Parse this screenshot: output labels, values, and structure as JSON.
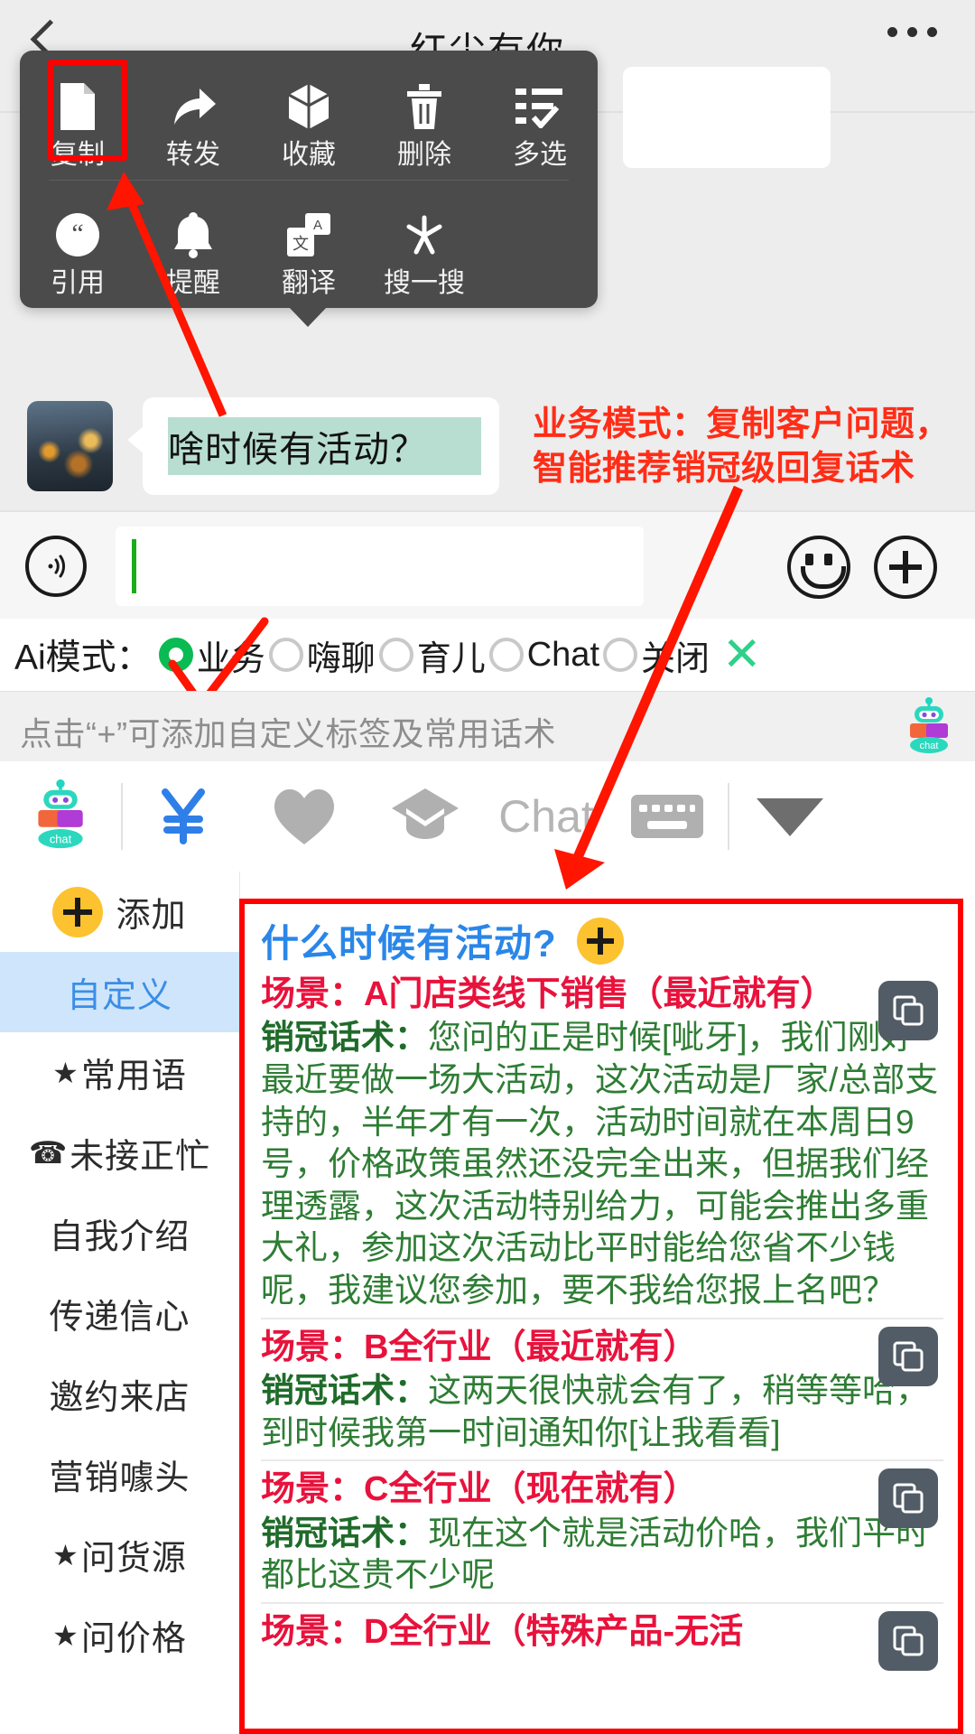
{
  "header": {
    "title": "红尘有你",
    "back_icon": "back-chevron-icon",
    "more_icon": "more-dots-icon"
  },
  "context_menu": {
    "row1": [
      {
        "label": "复制",
        "icon": "copy-document-icon",
        "highlighted": true
      },
      {
        "label": "转发",
        "icon": "forward-arrow-icon"
      },
      {
        "label": "收藏",
        "icon": "star-favorite-box-icon"
      },
      {
        "label": "删除",
        "icon": "trash-icon"
      },
      {
        "label": "多选",
        "icon": "multi-select-list-icon"
      }
    ],
    "row2": [
      {
        "label": "引用",
        "icon": "quote-icon"
      },
      {
        "label": "提醒",
        "icon": "bell-reminder-icon"
      },
      {
        "label": "翻译",
        "icon": "translate-icon"
      },
      {
        "label": "搜一搜",
        "icon": "search-spark-icon"
      }
    ]
  },
  "message": {
    "avatar": "contact-avatar",
    "text": "啥时候有活动？"
  },
  "annotation": {
    "line1": "业务模式：复制客户问题，",
    "line2": "智能推荐销冠级回复话术",
    "color": "#ff2d17"
  },
  "input_bar": {
    "voice_icon": "voice-wave-icon",
    "input_value": "",
    "input_placeholder": "",
    "emoji_icon": "smiley-face-icon",
    "plus_icon": "plus-circle-icon"
  },
  "ai_mode": {
    "label": "Ai模式：",
    "options": [
      {
        "label": "业务",
        "selected": true
      },
      {
        "label": "嗨聊",
        "selected": false
      },
      {
        "label": "育儿",
        "selected": false
      },
      {
        "label": "Chat",
        "selected": false
      },
      {
        "label": "关闭",
        "selected": false
      }
    ],
    "close_icon": "close-x-icon",
    "selected_color": "#09bb52",
    "close_color": "#2fd18a"
  },
  "hint_bar": {
    "text": "点击“+”可添加自定义标签及常用话术",
    "robot_icon": "chat-robot-icon",
    "robot_badge": "chat"
  },
  "toolbar": {
    "items": [
      {
        "icon": "chat-robot-icon",
        "label": "chat"
      },
      {
        "icon": "yen-currency-icon",
        "label": "¥"
      },
      {
        "icon": "heart-icon",
        "label": ""
      },
      {
        "icon": "graduation-cap-icon",
        "label": ""
      },
      {
        "icon": "chat-text-icon",
        "label": "Chat"
      },
      {
        "icon": "keyboard-icon",
        "label": ""
      },
      {
        "icon": "chevron-down-triangle-icon",
        "label": ""
      }
    ]
  },
  "sidebar": {
    "items": [
      {
        "label": "添加",
        "icon": "plus-circle-yellow-icon",
        "active": false
      },
      {
        "label": "自定义",
        "icon": "",
        "active": true
      },
      {
        "label": "常用语",
        "icon": "star-icon",
        "active": false
      },
      {
        "label": "未接正忙",
        "icon": "telephone-icon",
        "active": false
      },
      {
        "label": "自我介绍",
        "icon": "",
        "active": false
      },
      {
        "label": "传递信心",
        "icon": "",
        "active": false
      },
      {
        "label": "邀约来店",
        "icon": "",
        "active": false
      },
      {
        "label": "营销噱头",
        "icon": "",
        "active": false
      },
      {
        "label": "问货源",
        "icon": "star-icon",
        "active": false
      },
      {
        "label": "问价格",
        "icon": "star-icon",
        "active": false
      }
    ]
  },
  "answer_panel": {
    "question": "什么时候有活动?",
    "add_icon": "plus-circle-yellow-icon",
    "copy_icon": "copy-stack-icon",
    "scene_label": "场景：",
    "script_label": "销冠话术：",
    "blocks": [
      {
        "scene": "场景：A门店类线下销售（最近就有）",
        "script_prefix": "销冠话术：",
        "script": "您问的正是时候[呲牙]，我们刚好最近要做一场大活动，这次活动是厂家/总部支持的，半年才有一次，活动时间就在本周日9号，价格政策虽然还没完全出来，但据我们经理透露，这次活动特别给力，可能会推出多重大礼，参加这次活动比平时能给您省不少钱呢，我建议您参加，要不我给您报上名吧？"
      },
      {
        "scene": "场景：B全行业（最近就有）",
        "script_prefix": "销冠话术：",
        "script": "这两天很快就会有了，稍等等哈，到时候我第一时间通知你[让我看看]"
      },
      {
        "scene": "场景：C全行业（现在就有）",
        "script_prefix": "销冠话术：",
        "script": "现在这个就是活动价哈，我们平时都比这贵不少呢"
      },
      {
        "scene": "场景：D全行业（特殊产品-无活",
        "script_prefix": "",
        "script": ""
      }
    ]
  },
  "colors": {
    "accent_blue": "#2a86e8",
    "scene_red": "#e8123c",
    "script_green": "#2e7d34",
    "annotation_red": "#ff2d17",
    "highlight_red": "#ff0000",
    "yellow": "#fcc230",
    "green_radio": "#09bb52"
  }
}
